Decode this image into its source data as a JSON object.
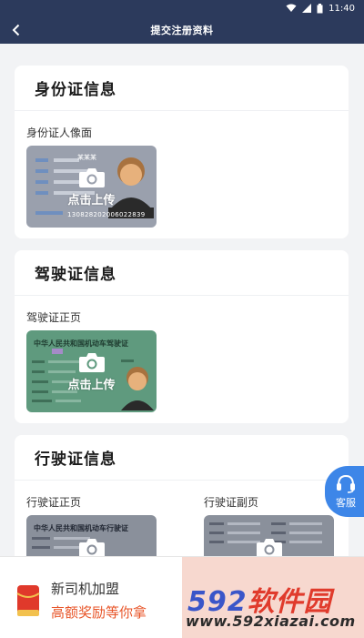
{
  "status_bar": {
    "time": "11:40"
  },
  "nav": {
    "title": "提交注册资料"
  },
  "sections": {
    "id_card": {
      "title": "身份证信息",
      "field_label": "身份证人像面",
      "upload_text": "点击上传",
      "sample_name": "某某某",
      "sample_number": "130828202006022839"
    },
    "driver_license": {
      "title": "驾驶证信息",
      "field_label": "驾驶证正页",
      "upload_text": "点击上传",
      "sample_heading": "中华人民共和国机动车驾驶证"
    },
    "vehicle_license": {
      "title": "行驶证信息",
      "front_label": "行驶证正页",
      "back_label": "行驶证副页",
      "sample_heading": "中华人民共和国机动车行驶证"
    }
  },
  "service": {
    "label": "客服"
  },
  "banner": {
    "line1": "新司机加盟",
    "line2": "高额奖励等你拿"
  },
  "watermark": {
    "num": "592",
    "cn": "软件园",
    "url": "www.592xiazai.com"
  },
  "colors": {
    "nav_bg": "#2c3a5c",
    "accent_blue": "#3d86e8",
    "promo_orange": "#e8562a",
    "id_card_bg": "#9aa0ad",
    "driver_card_bg": "#5f9a7e",
    "vehicle_card_bg": "#8a909b"
  }
}
